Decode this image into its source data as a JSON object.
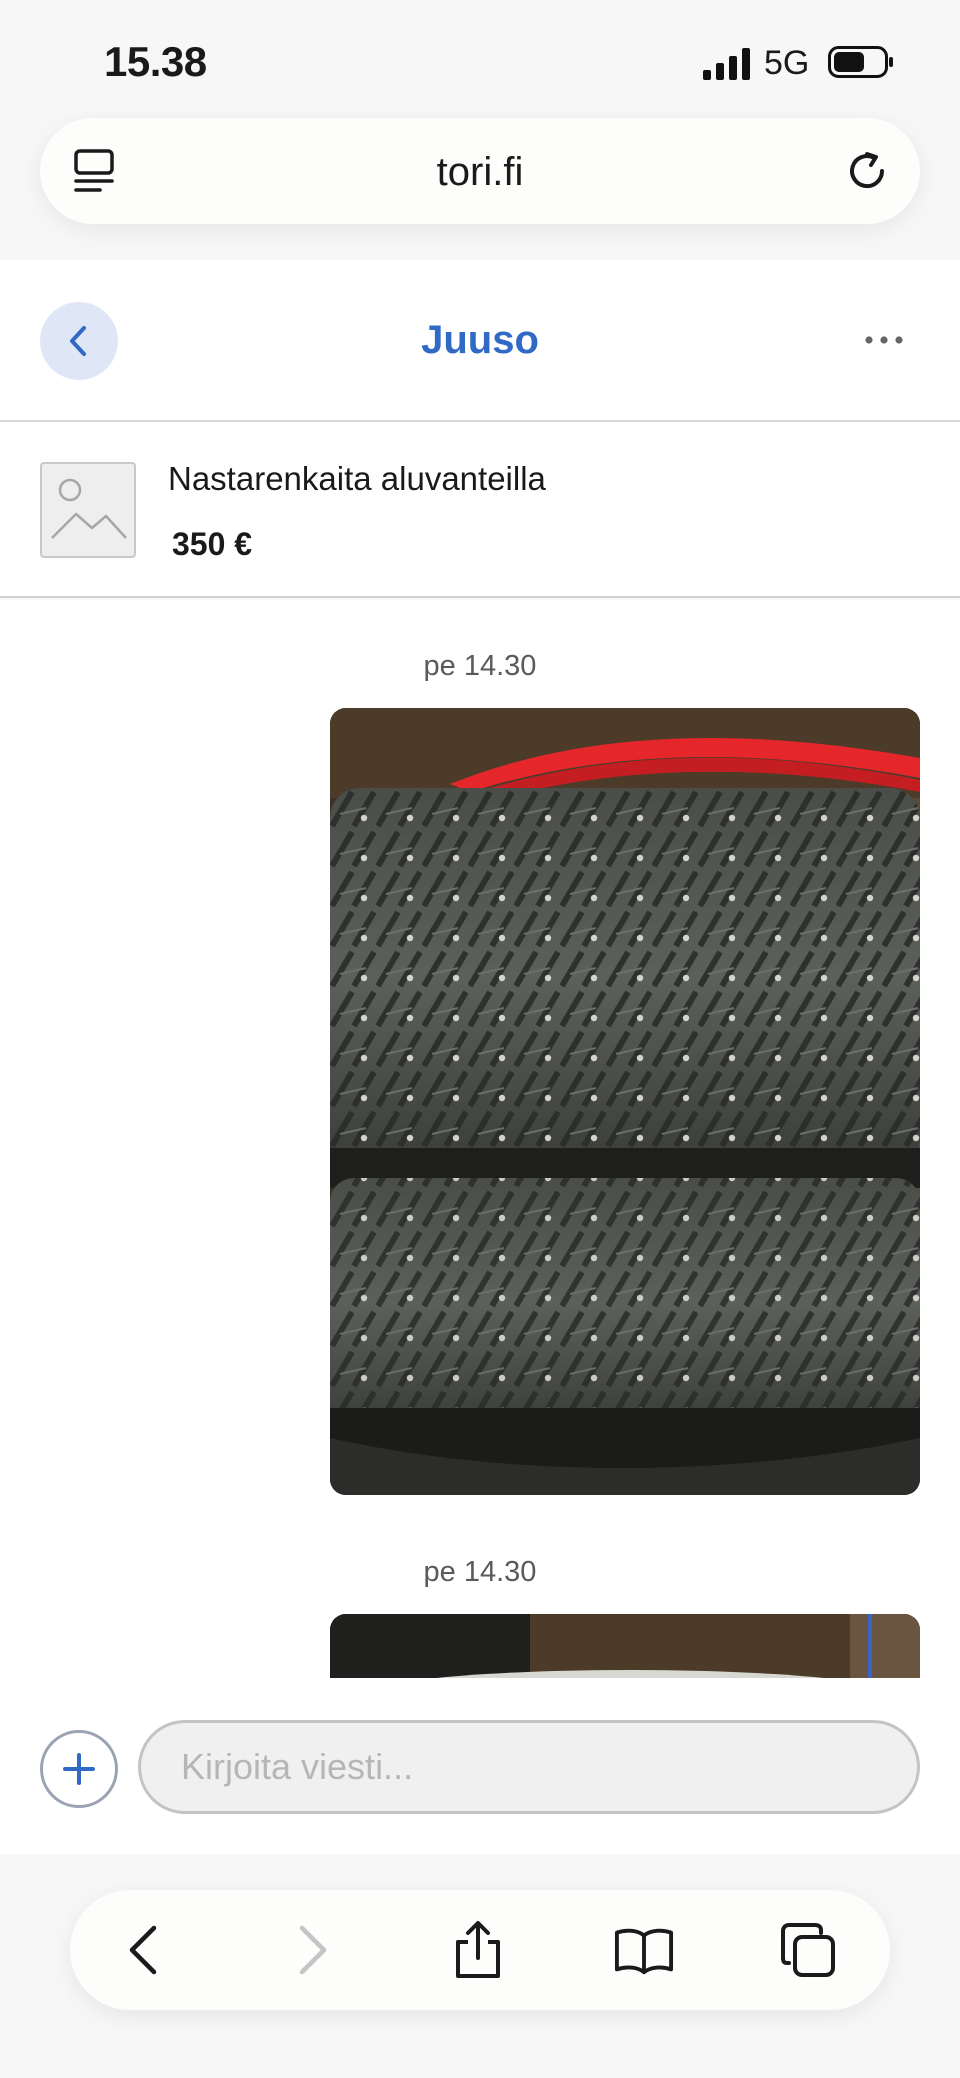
{
  "status_bar": {
    "time": "15.38",
    "network": "5G"
  },
  "browser": {
    "url": "tori.fi"
  },
  "header": {
    "title": "Juuso"
  },
  "listing": {
    "title": "Nastarenkaita aluvanteilla",
    "price": "350 €"
  },
  "messages": [
    {
      "timestamp": "pe 14.30"
    },
    {
      "timestamp": "pe 14.30"
    }
  ],
  "composer": {
    "placeholder": "Kirjoita viesti..."
  },
  "colors": {
    "accent": "#3169c6",
    "back_bg": "#dfe7f7"
  },
  "icons": {
    "reader": "reader-icon",
    "reload": "reload-icon",
    "back": "chevron-left-icon",
    "more": "more-icon",
    "add": "plus-icon",
    "nav_back": "chevron-left-icon",
    "nav_forward": "chevron-right-icon",
    "share": "share-icon",
    "bookmarks": "book-icon",
    "tabs": "tabs-icon"
  }
}
